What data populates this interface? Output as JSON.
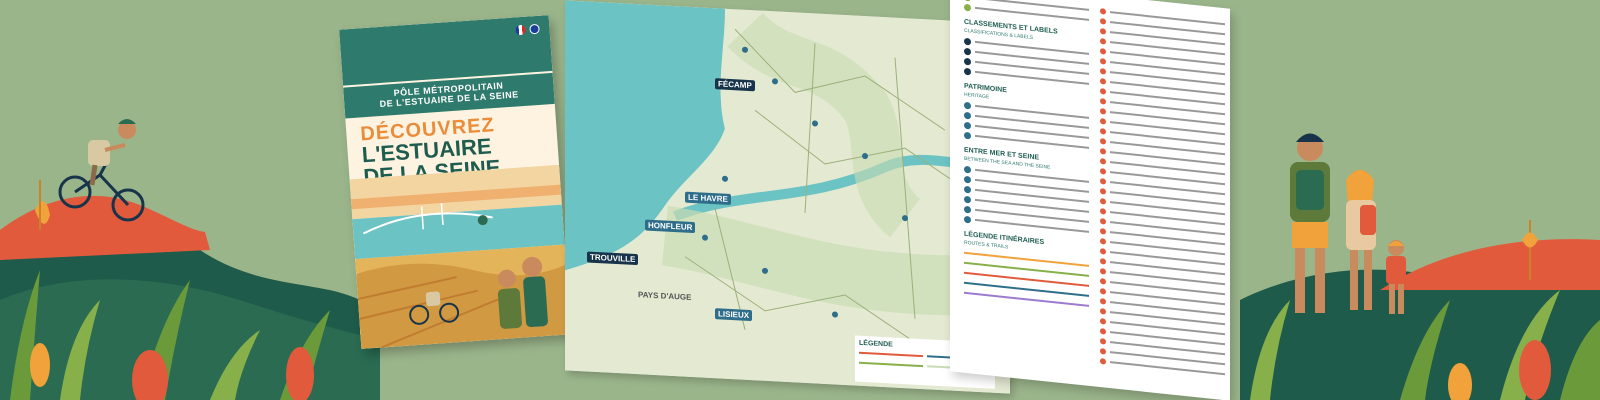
{
  "brochure": {
    "pole_line1": "PÔLE MÉTROPOLITAIN",
    "pole_line2": "DE L'ESTUAIRE DE LA SEINE",
    "title_line1": "DÉCOUVREZ",
    "title_line2": "L'ESTUAIRE",
    "title_line3": "DE LA SEINE"
  },
  "map": {
    "place_labels": [
      "FÉCAMP",
      "LE HAVRE",
      "TROUVILLE",
      "HONFLEUR",
      "LISIEUX",
      "PAYS D'AUGE"
    ],
    "legend_title": "LÉGENDE"
  },
  "panel": {
    "sections": [
      {
        "title": "CLASSEMENTS ET LABELS",
        "subtitle": "CLASSIFICATIONS & LABELS"
      },
      {
        "title": "PATRIMOINE",
        "subtitle": "HERITAGE"
      },
      {
        "title": "ENTRE MER ET SEINE",
        "subtitle": "BETWEEN THE SEA AND THE SEINE"
      },
      {
        "title": "LÉGENDE ITINÉRAIRES",
        "subtitle": "ROUTES & TRAILS"
      }
    ]
  },
  "colors": {
    "background": "#9bb58b",
    "brand_green": "#2e7a6c",
    "title_orange": "#e98d3a",
    "title_green": "#1e5c50",
    "sea": "#6cc3c4",
    "accent_red": "#e25a3c"
  }
}
